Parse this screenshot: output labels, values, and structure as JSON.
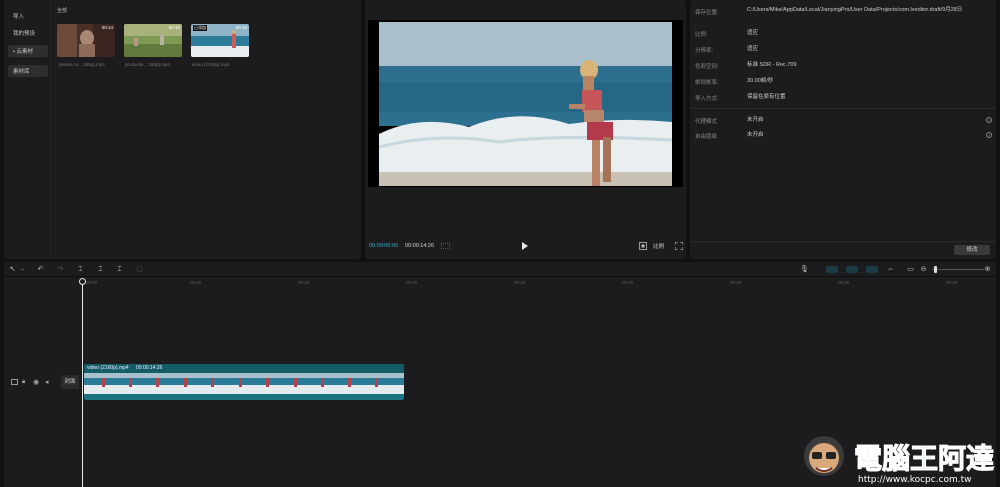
{
  "media": {
    "sidebar": [
      {
        "label": "导入",
        "active": false
      },
      {
        "label": "我的预设",
        "active": false
      },
      {
        "label": "• 云素材",
        "active": true
      },
      {
        "label": "素材库",
        "active": true
      }
    ],
    "section_label": "全部",
    "items": [
      {
        "name": "pexels-co....160p).mp4",
        "duration": "00:14",
        "badge": ""
      },
      {
        "name": "productio....160p).mp4",
        "duration": "00:15",
        "badge": ""
      },
      {
        "name": "video (2160p).mp4",
        "duration": "00:15",
        "badge": "已添加"
      }
    ]
  },
  "player": {
    "current_time": "00:00:00:00",
    "total_time": "00:00:14:26",
    "ratio_label": "比例"
  },
  "details": {
    "rows": [
      {
        "label": "保存位置:",
        "value": "C:/Users/Mike/AppData/Local/JianyingPro/User Data/Projects/com.lveditor.draft/9月28日"
      },
      {
        "label": "比例:",
        "value": "适应"
      },
      {
        "label": "分辨率:",
        "value": "适应"
      },
      {
        "label": "色彩空间:",
        "value": "标准 SDR - Rec.709"
      },
      {
        "label": "帧视帧率:",
        "value": "30.00帧/秒"
      },
      {
        "label": "导入方式:",
        "value": "保留在原有位置"
      }
    ],
    "rows2": [
      {
        "label": "代理模式",
        "value": "未开启"
      },
      {
        "label": "自由层级",
        "value": "未开启"
      }
    ],
    "modify_label": "修改"
  },
  "timeline": {
    "ticks": [
      "00:00",
      "00:05",
      "00:10",
      "00:15",
      "00:20",
      "00:25",
      "00:30",
      "00:35",
      "00:40"
    ],
    "cover_label": "封面",
    "clip_name": "video (2160p).mp4",
    "clip_duration": "00:00:14:26"
  },
  "watermark": {
    "title": "電腦王阿達",
    "url": "http://www.kocpc.com.tw"
  }
}
